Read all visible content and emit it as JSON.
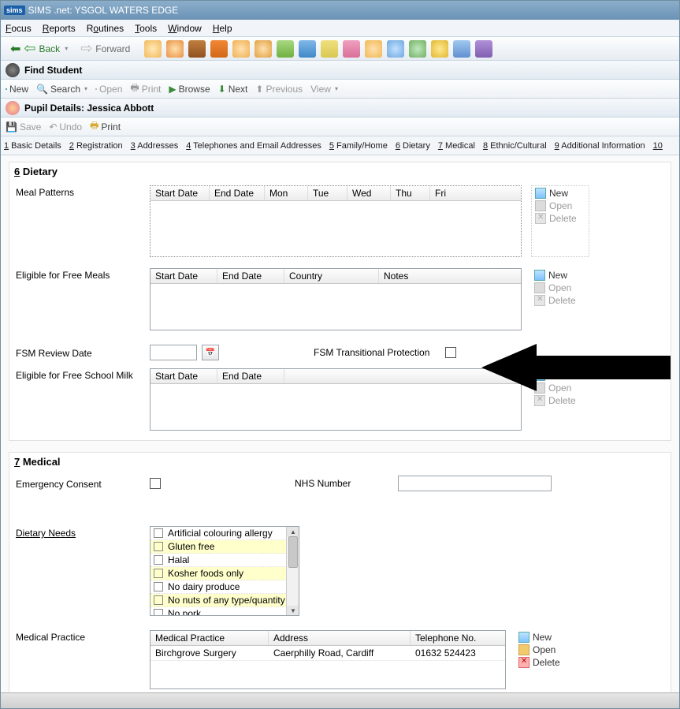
{
  "window": {
    "title": "SIMS .net: YSGOL WATERS EDGE",
    "logo": "sims"
  },
  "menu": {
    "focus": "Focus",
    "reports": "Reports",
    "routines": "Routines",
    "tools": "Tools",
    "window": "Window",
    "help": "Help"
  },
  "nav": {
    "back": "Back",
    "forward": "Forward"
  },
  "find_panel": {
    "title": "Find Student"
  },
  "find_toolbar": {
    "new": "New",
    "search": "Search",
    "open": "Open",
    "print": "Print",
    "browse": "Browse",
    "next": "Next",
    "previous": "Previous",
    "view": "View"
  },
  "details_panel": {
    "title": "Pupil Details: Jessica Abbott"
  },
  "details_toolbar": {
    "save": "Save",
    "undo": "Undo",
    "print": "Print"
  },
  "tabs": {
    "t1": "1 Basic Details",
    "t2": "2 Registration",
    "t3": "3 Addresses",
    "t4": "4 Telephones and Email Addresses",
    "t5": "5 Family/Home",
    "t6": "6 Dietary",
    "t7": "7 Medical",
    "t8": "8 Ethnic/Cultural",
    "t9": "9 Additional Information",
    "t10": "10 "
  },
  "dietary": {
    "heading": "6 Dietary",
    "meal_patterns": {
      "label": "Meal Patterns",
      "cols": {
        "c1": "Start Date",
        "c2": "End Date",
        "c3": "Mon",
        "c4": "Tue",
        "c5": "Wed",
        "c6": "Thu",
        "c7": "Fri"
      }
    },
    "free_meals": {
      "label": "Eligible for Free Meals",
      "cols": {
        "c1": "Start Date",
        "c2": "End Date",
        "c3": "Country",
        "c4": "Notes"
      }
    },
    "fsm_review": {
      "label": "FSM Review Date",
      "value": ""
    },
    "fsm_trans": {
      "label": "FSM Transitional Protection"
    },
    "school_milk": {
      "label": "Eligible for Free School Milk",
      "cols": {
        "c1": "Start Date",
        "c2": "End Date"
      }
    }
  },
  "medical": {
    "heading": "7 Medical",
    "emergency": "Emergency Consent",
    "nhs": "NHS Number",
    "nhs_value": "",
    "dietary_needs": {
      "label": "Dietary Needs",
      "items": {
        "i0": "Artificial colouring allergy",
        "i1": "Gluten free",
        "i2": "Halal",
        "i3": "Kosher foods only",
        "i4": "No dairy produce",
        "i5": "No nuts of any type/quantity",
        "i6": "No pork"
      }
    },
    "practice": {
      "label": "Medical Practice",
      "cols": {
        "c1": "Medical Practice",
        "c2": "Address",
        "c3": "Telephone No."
      },
      "rows": {
        "r0": {
          "name": "Birchgrove Surgery",
          "addr": "Caerphilly Road, Cardiff",
          "tel": "01632 524423"
        }
      }
    }
  },
  "actions": {
    "new": "New",
    "open": "Open",
    "delete": "Delete"
  },
  "icons": {
    "c0": "#f2c85a",
    "c1": "#f28b3a",
    "c2": "#b56a2a",
    "c3": "#e07030",
    "c4": "#f5be6b",
    "c5": "#e2a24e",
    "c6": "#78b845",
    "c7": "#4f95d6",
    "c8": "#e8d96a",
    "c9": "#e58fb1",
    "c10": "#f2c85a",
    "c11": "#7bb0e0",
    "c12": "#78b86d",
    "c13": "#f0c24a",
    "c14": "#6aa8e0",
    "c15": "#8c6fbf"
  }
}
